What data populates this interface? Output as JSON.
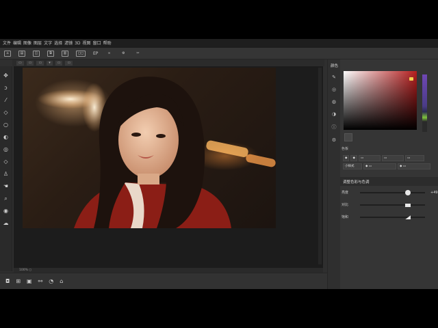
{
  "menubar": {
    "items": [
      "文件",
      "编辑",
      "图像",
      "图层",
      "文字",
      "选择",
      "滤镜",
      "3D",
      "视图",
      "窗口",
      "帮助"
    ]
  },
  "toolbar": {
    "items": [
      {
        "icon": "home-icon",
        "label": ""
      },
      {
        "icon": "new-doc-icon",
        "label": ""
      },
      {
        "icon": "layers-icon",
        "label": ""
      },
      {
        "icon": "copy-icon",
        "label": ""
      },
      {
        "icon": "trash-icon",
        "label": ""
      },
      {
        "icon": "zoom-icon",
        "label": ""
      },
      {
        "icon": "text-icon",
        "label": "EP"
      },
      {
        "icon": "link-icon",
        "label": ""
      },
      {
        "icon": "settings-icon",
        "label": ""
      },
      {
        "icon": "crop-icon",
        "label": ""
      }
    ]
  },
  "options_bar": {
    "items": [
      "▭",
      "▭",
      "▭",
      "▾",
      "▭",
      "▭"
    ]
  },
  "tools": [
    "move",
    "lasso",
    "brush",
    "eraser",
    "circle",
    "gradient",
    "stamp",
    "shape",
    "person",
    "hand",
    "zoom",
    "eye",
    "cloud"
  ],
  "canvas": {
    "status": "100% ○"
  },
  "bottom_bar": {
    "items": [
      "camera-icon",
      "layers-icon",
      "image-icon",
      "adjust-icon",
      "mask-icon",
      "trash-icon"
    ]
  },
  "right_panel": {
    "color_title": "颜色",
    "swatch_label": "色板",
    "panel_icons": [
      "brush-icon",
      "circle-icon",
      "bubble-icon",
      "palette-icon",
      "info-icon",
      "gear-icon"
    ],
    "prop_rows": [
      [
        "◆",
        "◆",
        "▭",
        "▭",
        "▭"
      ],
      [
        "小样式",
        "◆ ▭",
        "◆ ▭"
      ]
    ],
    "adjust_title": "调整色彩与色调",
    "sliders": [
      {
        "label": "亮度",
        "value_label": "+49",
        "value": 0.74
      },
      {
        "label": "对比",
        "value_label": "",
        "value": 0.74
      },
      {
        "label": "饱和",
        "value_label": "",
        "value": 0.74
      }
    ],
    "accent_color": "#b41d1d"
  }
}
